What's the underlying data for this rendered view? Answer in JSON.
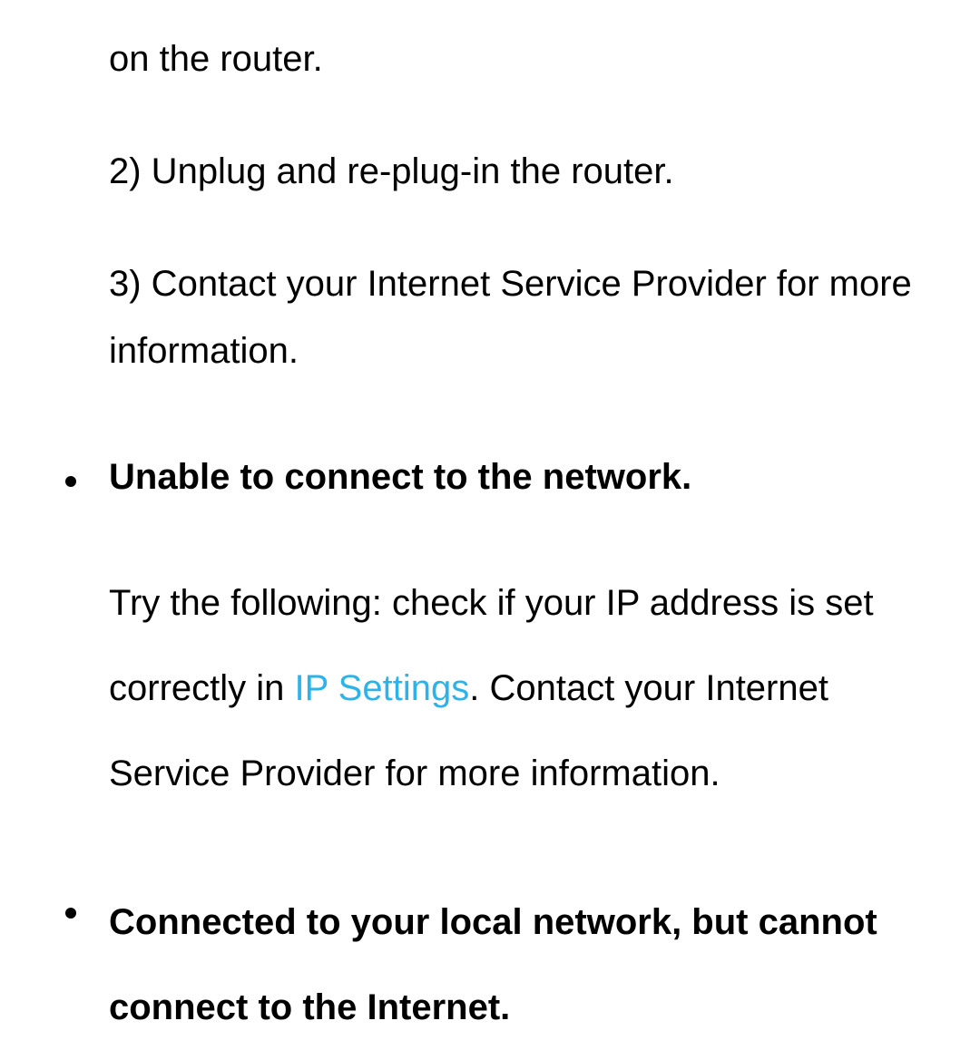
{
  "fragment_top": "on the router.",
  "steps": {
    "s2": "2) Unplug and re-plug-in the router.",
    "s3": "3) Contact your Internet Service Provider for more information."
  },
  "bullets": [
    {
      "heading": "Unable to connect to the network.",
      "body_before": "Try the following: check if your IP address is set correctly in ",
      "link": "IP Settings",
      "body_after": ". Contact your Internet Service Provider for more information."
    },
    {
      "heading": "Connected to your local network, but cannot connect to the Internet."
    }
  ],
  "colors": {
    "link": "#2db3ea"
  }
}
